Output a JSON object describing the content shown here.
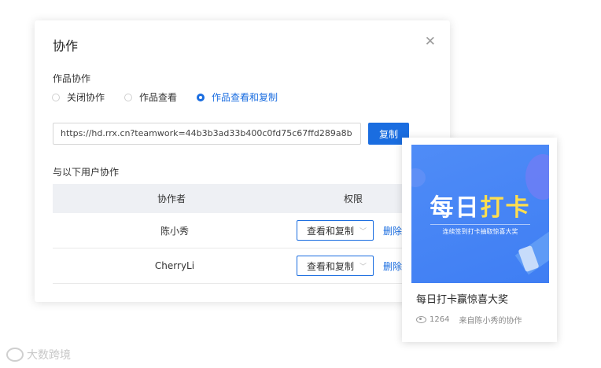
{
  "dialog": {
    "title": "协作",
    "close_icon": "close-icon",
    "permission_section_label": "作品协作",
    "radio_options": [
      "关闭协作",
      "作品查看",
      "作品查看和复制"
    ],
    "selected_option": "作品查看和复制",
    "link_value": "https://hd.rrx.cn?teamwork=44b3b3ad33b400c0fd75c67ffd289a8b",
    "copy_label": "复制",
    "users_section_label": "与以下用户协作",
    "table": {
      "headers": [
        "协作者",
        "权限"
      ],
      "rows": [
        {
          "name": "陈小秀",
          "permission": "查看和复制",
          "action": "删除"
        },
        {
          "name": "CherryLi",
          "permission": "查看和复制",
          "action": "删除"
        }
      ]
    }
  },
  "card": {
    "banner_title_part1": "每日",
    "banner_title_part2": "打卡",
    "banner_subtitle": "连续签到打卡抽取惊喜大奖",
    "title": "每日打卡赢惊喜大奖",
    "views": "1264",
    "source": "来自陈小秀的协作"
  },
  "watermark": {
    "text": "大数跨境"
  },
  "colors": {
    "accent": "#1a6de0",
    "banner": "#4a88f5",
    "banner_highlight": "#ffde4f"
  }
}
